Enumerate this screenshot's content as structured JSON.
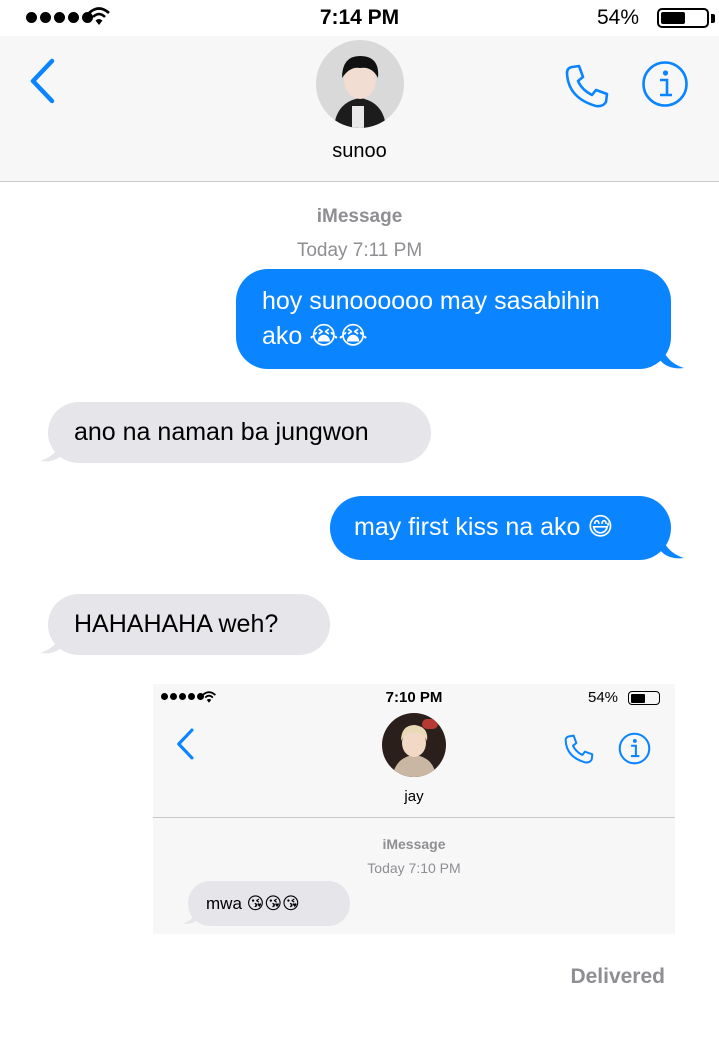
{
  "status_bar": {
    "time": "7:14 PM",
    "battery": "54%",
    "battery_level": 0.54,
    "signal_bars": 5
  },
  "header": {
    "contact_name": "sunoo"
  },
  "conversation": {
    "service": "iMessage",
    "timestamp": "Today 7:11 PM",
    "messages": [
      {
        "direction": "outgoing",
        "text": "hoy sunoooooo may sasabihin ako 😭😭"
      },
      {
        "direction": "incoming",
        "text": "ano na naman ba jungwon"
      },
      {
        "direction": "outgoing",
        "text": "may first kiss na ako 😅"
      },
      {
        "direction": "incoming",
        "text": "HAHAHAHA weh?"
      }
    ],
    "delivered_label": "Delivered"
  },
  "embedded_screenshot": {
    "time": "7:10 PM",
    "battery": "54%",
    "contact_name": "jay",
    "service": "iMessage",
    "timestamp": "Today 7:10 PM",
    "message": "mwa 😘😘😘"
  },
  "colors": {
    "accent": "#0a84ff",
    "outgoing_bubble": "#0a84ff",
    "incoming_bubble": "#e5e5ea",
    "meta_gray": "#8e8e93"
  },
  "icons": [
    "signal-dots",
    "wifi-icon",
    "battery-icon",
    "back-chevron-icon",
    "phone-icon",
    "info-icon"
  ]
}
